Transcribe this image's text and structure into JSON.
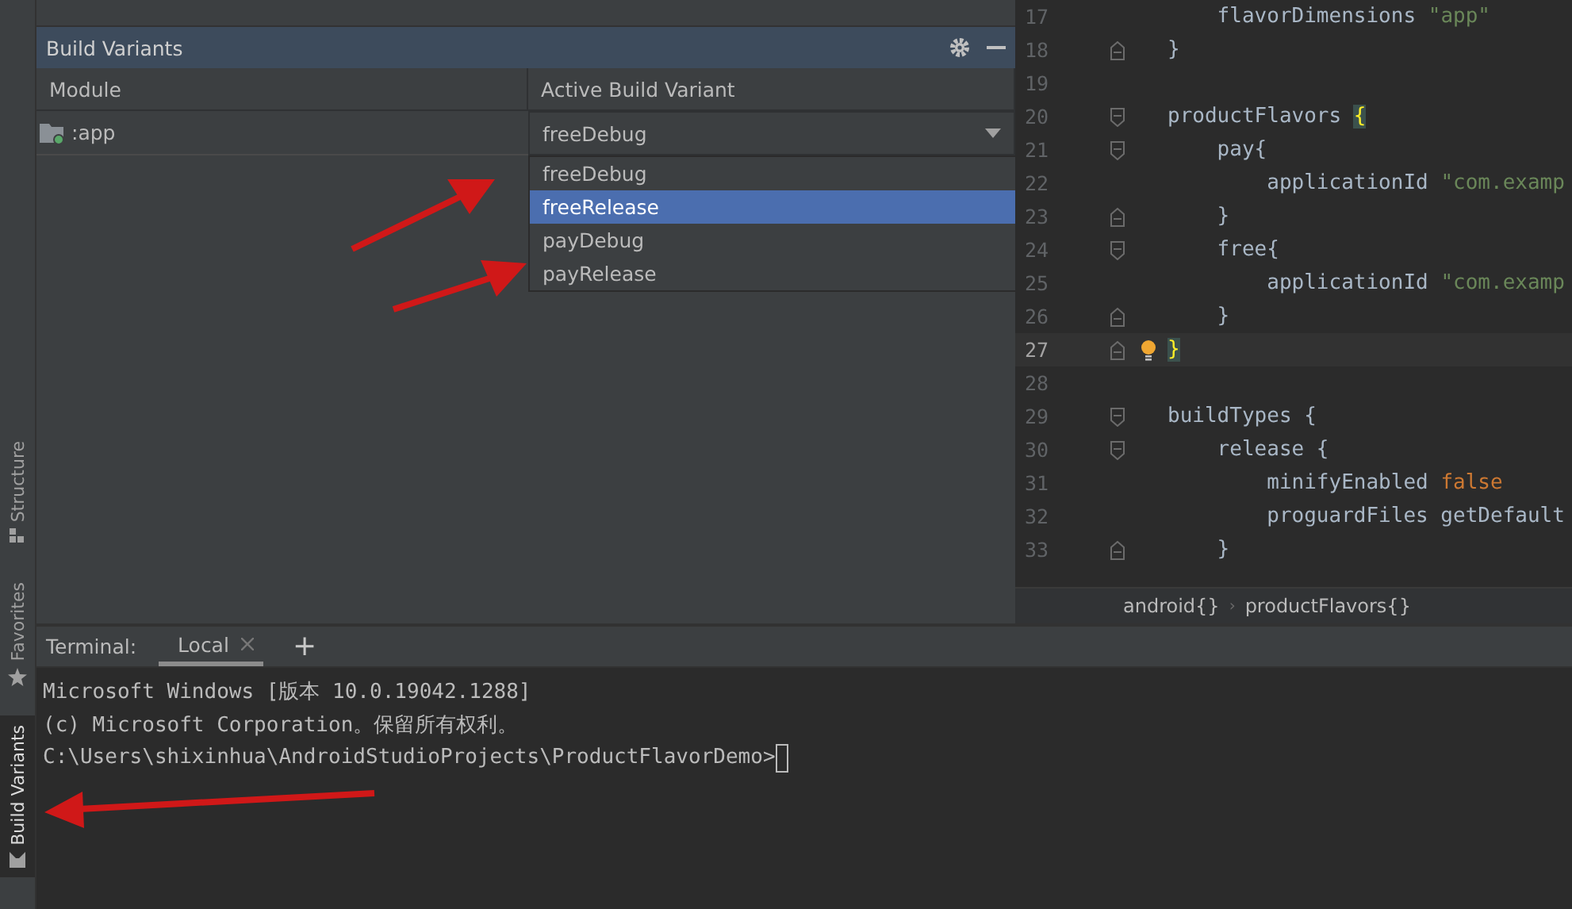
{
  "side_tabs": [
    {
      "label": "Structure",
      "selected": false
    },
    {
      "label": "Favorites",
      "selected": false
    },
    {
      "label": "Build Variants",
      "selected": true
    }
  ],
  "build_variants": {
    "title": "Build Variants",
    "columns": [
      "Module",
      "Active Build Variant"
    ],
    "rows": [
      {
        "module": ":app",
        "variant": "freeDebug",
        "expanded": true
      }
    ],
    "options": [
      {
        "label": "freeDebug",
        "selected": false
      },
      {
        "label": "freeRelease",
        "selected": true
      },
      {
        "label": "payDebug",
        "selected": false
      },
      {
        "label": "payRelease",
        "selected": false
      }
    ]
  },
  "editor": {
    "lines": [
      {
        "number": "17",
        "current": false,
        "fold_open": false,
        "fold_close": false,
        "bulb": false,
        "tokens": [
          {
            "text": "    flavorDimensions ",
            "kind": "plain"
          },
          {
            "text": "\"app\"",
            "kind": "string"
          }
        ]
      },
      {
        "number": "18",
        "current": false,
        "fold_open": false,
        "fold_close": true,
        "bulb": false,
        "tokens": [
          {
            "text": "}",
            "kind": "plain"
          }
        ]
      },
      {
        "number": "19",
        "current": false,
        "fold_open": false,
        "fold_close": false,
        "bulb": false
      },
      {
        "number": "20",
        "current": false,
        "fold_open": true,
        "fold_close": false,
        "bulb": false,
        "tokens": [
          {
            "text": "productFlavors ",
            "kind": "plain"
          },
          {
            "text": "{",
            "kind": "brace_match"
          }
        ]
      },
      {
        "number": "21",
        "current": false,
        "fold_open": true,
        "fold_close": false,
        "bulb": false,
        "tokens": [
          {
            "text": "    pay{",
            "kind": "plain"
          }
        ]
      },
      {
        "number": "22",
        "current": false,
        "fold_open": false,
        "fold_close": false,
        "bulb": false,
        "tokens": [
          {
            "text": "        applicationId ",
            "kind": "plain"
          },
          {
            "text": "\"com.examp",
            "kind": "string"
          }
        ]
      },
      {
        "number": "23",
        "current": false,
        "fold_open": false,
        "fold_close": true,
        "bulb": false,
        "tokens": [
          {
            "text": "    }",
            "kind": "plain"
          }
        ]
      },
      {
        "number": "24",
        "current": false,
        "fold_open": true,
        "fold_close": false,
        "bulb": false,
        "tokens": [
          {
            "text": "    free{",
            "kind": "plain"
          }
        ]
      },
      {
        "number": "25",
        "current": false,
        "fold_open": false,
        "fold_close": false,
        "bulb": false,
        "tokens": [
          {
            "text": "        applicationId ",
            "kind": "plain"
          },
          {
            "text": "\"com.examp",
            "kind": "string"
          }
        ]
      },
      {
        "number": "26",
        "current": false,
        "fold_open": false,
        "fold_close": true,
        "bulb": false,
        "tokens": [
          {
            "text": "    }",
            "kind": "plain"
          }
        ]
      },
      {
        "number": "27",
        "current": true,
        "fold_open": false,
        "fold_close": true,
        "bulb": true,
        "tokens": [
          {
            "text": "}",
            "kind": "brace_match"
          }
        ]
      },
      {
        "number": "28",
        "current": false,
        "fold_open": false,
        "fold_close": false,
        "bulb": false
      },
      {
        "number": "29",
        "current": false,
        "fold_open": true,
        "fold_close": false,
        "bulb": false,
        "tokens": [
          {
            "text": "buildTypes {",
            "kind": "plain"
          }
        ]
      },
      {
        "number": "30",
        "current": false,
        "fold_open": true,
        "fold_close": false,
        "bulb": false,
        "tokens": [
          {
            "text": "    release {",
            "kind": "plain"
          }
        ]
      },
      {
        "number": "31",
        "current": false,
        "fold_open": false,
        "fold_close": false,
        "bulb": false,
        "tokens": [
          {
            "text": "        minifyEnabled ",
            "kind": "plain"
          },
          {
            "text": "false",
            "kind": "keyword"
          }
        ]
      },
      {
        "number": "32",
        "current": false,
        "fold_open": false,
        "fold_close": false,
        "bulb": false,
        "tokens": [
          {
            "text": "        proguardFiles getDefault",
            "kind": "plain"
          }
        ]
      },
      {
        "number": "33",
        "current": false,
        "fold_open": false,
        "fold_close": true,
        "bulb": false,
        "tokens": [
          {
            "text": "    }",
            "kind": "plain"
          }
        ]
      }
    ],
    "breadcrumbs": [
      "android{}",
      "productFlavors{}"
    ],
    "breadcrumb_separator": "›"
  },
  "terminal": {
    "label": "Terminal:",
    "tabs": [
      {
        "label": "Local",
        "selected": true
      }
    ],
    "add": "+",
    "lines": [
      "Microsoft Windows [版本 10.0.19042.1288]",
      "(c) Microsoft Corporation。保留所有权利。",
      "C:\\Users\\shixinhua\\AndroidStudioProjects\\ProductFlavorDemo>"
    ]
  }
}
